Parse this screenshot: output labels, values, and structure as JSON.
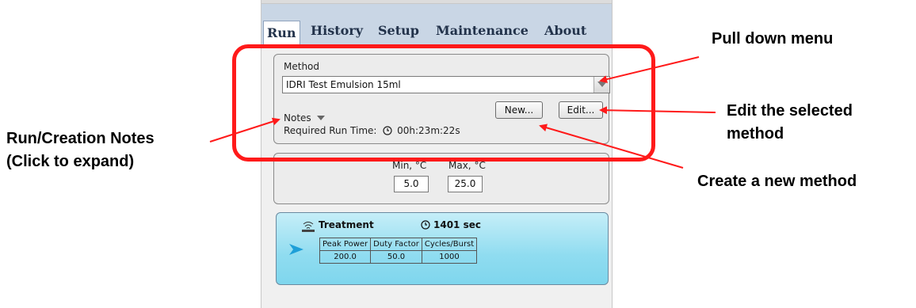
{
  "tabs": [
    {
      "label": "Run",
      "active": true
    },
    {
      "label": "History",
      "active": false
    },
    {
      "label": "Setup",
      "active": false
    },
    {
      "label": "Maintenance",
      "active": false
    },
    {
      "label": "About",
      "active": false
    }
  ],
  "method": {
    "label": "Method",
    "selected": "IDRI Test Emulsion 15ml",
    "new_button": "New...",
    "edit_button": "Edit...",
    "notes_label": "Notes",
    "runtime_label": "Required Run Time:",
    "runtime_value": "00h:23m:22s"
  },
  "temperature": {
    "min_label": "Min, °C",
    "max_label": "Max, °C",
    "min_value": "5.0",
    "max_value": "25.0"
  },
  "treatment": {
    "title": "Treatment",
    "time": "1401 sec",
    "headers": [
      "Peak Power",
      "Duty Factor",
      "Cycles/Burst"
    ],
    "values": [
      "200.0",
      "50.0",
      "1000"
    ]
  },
  "annotations": {
    "pull_down": "Pull down menu",
    "edit_line1": "Edit the selected",
    "edit_line2": "method",
    "notes_line1": "Run/Creation Notes",
    "notes_line2": "(Click to expand)",
    "create_new": "Create a new method"
  },
  "colors": {
    "annotation_red": "#ff1a1a",
    "tab_bar": "#c9d6e5",
    "treatment_panel": "#8fdcf0"
  }
}
